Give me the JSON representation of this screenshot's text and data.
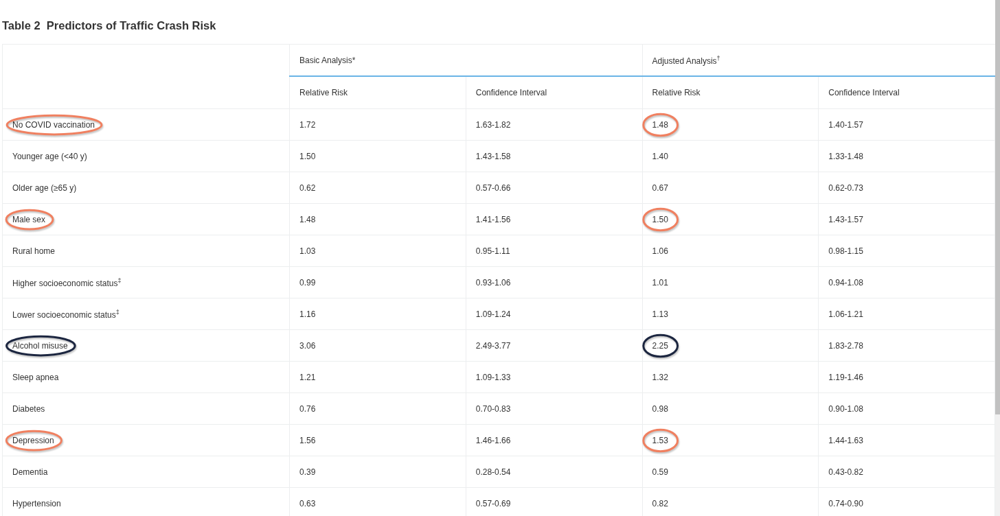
{
  "title": "Table 2  Predictors of Traffic Crash Risk",
  "table": {
    "groups": [
      "Basic Analysis*",
      "Adjusted Analysis$^{†}$"
    ],
    "columns": [
      "Relative Risk",
      "Confidence Interval",
      "Relative Risk",
      "Confidence Interval"
    ],
    "rows": [
      {
        "label": "No COVID vaccination",
        "cells": [
          "1.72",
          "1.63-1.82",
          "1.48",
          "1.40-1.57"
        ],
        "color": "#f08060"
      },
      {
        "label": "Younger age (<40 y)",
        "cells": [
          "1.50",
          "1.43-1.58",
          "1.40",
          "1.33-1.48"
        ]
      },
      {
        "label": "Older age (≥65 y)",
        "cells": [
          "0.62",
          "0.57-0.66",
          "0.67",
          "0.62-0.73"
        ]
      },
      {
        "label": "Male sex",
        "cells": [
          "1.48",
          "1.41-1.56",
          "1.50",
          "1.43-1.57"
        ],
        "color": "#f08060"
      },
      {
        "label": "Rural home",
        "cells": [
          "1.03",
          "0.95-1.11",
          "1.06",
          "0.98-1.15"
        ]
      },
      {
        "label": "Higher socioeconomic status$^{‡}$",
        "cells": [
          "0.99",
          "0.93-1.06",
          "1.01",
          "0.94-1.08"
        ]
      },
      {
        "label": "Lower socioeconomic status$^{‡}$",
        "cells": [
          "1.16",
          "1.09-1.24",
          "1.13",
          "1.06-1.21"
        ]
      },
      {
        "label": "Alcohol misuse",
        "cells": [
          "3.06",
          "2.49-3.77",
          "2.25",
          "1.83-2.78"
        ],
        "color": "#1c2640"
      },
      {
        "label": "Sleep apnea",
        "cells": [
          "1.21",
          "1.09-1.33",
          "1.32",
          "1.19-1.46"
        ]
      },
      {
        "label": "Diabetes",
        "cells": [
          "0.76",
          "0.70-0.83",
          "0.98",
          "0.90-1.08"
        ]
      },
      {
        "label": "Depression",
        "cells": [
          "1.56",
          "1.46-1.66",
          "1.53",
          "1.44-1.63"
        ],
        "color": "#f08060"
      },
      {
        "label": "Dementia",
        "cells": [
          "0.39",
          "0.28-0.54",
          "0.59",
          "0.43-0.82"
        ]
      },
      {
        "label": "Hypertension",
        "cells": [
          "0.63",
          "0.57-0.69",
          "0.82",
          "0.74-0.90"
        ]
      }
    ]
  }
}
